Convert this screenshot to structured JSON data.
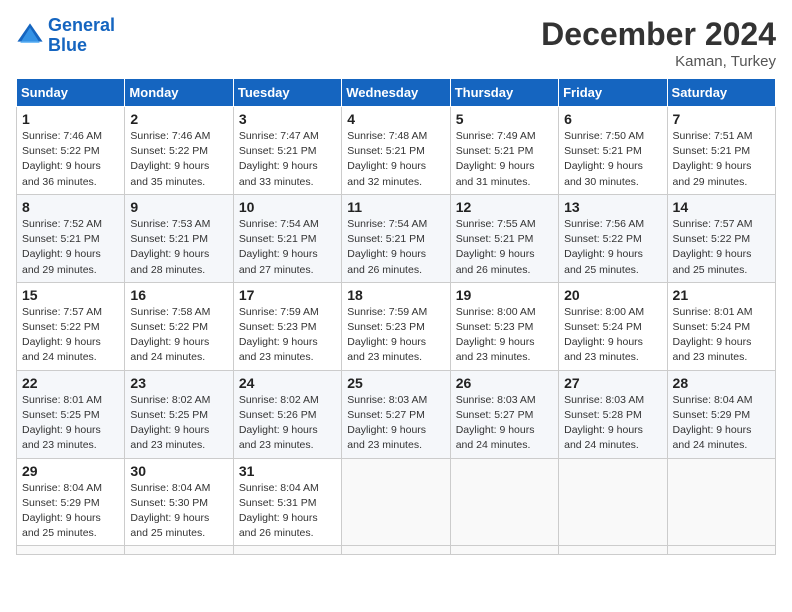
{
  "header": {
    "logo_line1": "General",
    "logo_line2": "Blue",
    "month_title": "December 2024",
    "location": "Kaman, Turkey"
  },
  "weekdays": [
    "Sunday",
    "Monday",
    "Tuesday",
    "Wednesday",
    "Thursday",
    "Friday",
    "Saturday"
  ],
  "days": [
    {
      "date": "",
      "sunrise": "",
      "sunset": "",
      "daylight": ""
    },
    {
      "date": "",
      "sunrise": "",
      "sunset": "",
      "daylight": ""
    },
    {
      "date": "",
      "sunrise": "",
      "sunset": "",
      "daylight": ""
    },
    {
      "date": "",
      "sunrise": "",
      "sunset": "",
      "daylight": ""
    },
    {
      "date": "",
      "sunrise": "",
      "sunset": "",
      "daylight": ""
    },
    {
      "date": "",
      "sunrise": "",
      "sunset": "",
      "daylight": ""
    },
    {
      "date": "1",
      "sunrise": "Sunrise: 7:46 AM",
      "sunset": "Sunset: 5:22 PM",
      "daylight": "Daylight: 9 hours and 36 minutes."
    },
    {
      "date": "2",
      "sunrise": "Sunrise: 7:46 AM",
      "sunset": "Sunset: 5:22 PM",
      "daylight": "Daylight: 9 hours and 35 minutes."
    },
    {
      "date": "3",
      "sunrise": "Sunrise: 7:47 AM",
      "sunset": "Sunset: 5:21 PM",
      "daylight": "Daylight: 9 hours and 33 minutes."
    },
    {
      "date": "4",
      "sunrise": "Sunrise: 7:48 AM",
      "sunset": "Sunset: 5:21 PM",
      "daylight": "Daylight: 9 hours and 32 minutes."
    },
    {
      "date": "5",
      "sunrise": "Sunrise: 7:49 AM",
      "sunset": "Sunset: 5:21 PM",
      "daylight": "Daylight: 9 hours and 31 minutes."
    },
    {
      "date": "6",
      "sunrise": "Sunrise: 7:50 AM",
      "sunset": "Sunset: 5:21 PM",
      "daylight": "Daylight: 9 hours and 30 minutes."
    },
    {
      "date": "7",
      "sunrise": "Sunrise: 7:51 AM",
      "sunset": "Sunset: 5:21 PM",
      "daylight": "Daylight: 9 hours and 29 minutes."
    },
    {
      "date": "8",
      "sunrise": "Sunrise: 7:52 AM",
      "sunset": "Sunset: 5:21 PM",
      "daylight": "Daylight: 9 hours and 29 minutes."
    },
    {
      "date": "9",
      "sunrise": "Sunrise: 7:53 AM",
      "sunset": "Sunset: 5:21 PM",
      "daylight": "Daylight: 9 hours and 28 minutes."
    },
    {
      "date": "10",
      "sunrise": "Sunrise: 7:54 AM",
      "sunset": "Sunset: 5:21 PM",
      "daylight": "Daylight: 9 hours and 27 minutes."
    },
    {
      "date": "11",
      "sunrise": "Sunrise: 7:54 AM",
      "sunset": "Sunset: 5:21 PM",
      "daylight": "Daylight: 9 hours and 26 minutes."
    },
    {
      "date": "12",
      "sunrise": "Sunrise: 7:55 AM",
      "sunset": "Sunset: 5:21 PM",
      "daylight": "Daylight: 9 hours and 26 minutes."
    },
    {
      "date": "13",
      "sunrise": "Sunrise: 7:56 AM",
      "sunset": "Sunset: 5:22 PM",
      "daylight": "Daylight: 9 hours and 25 minutes."
    },
    {
      "date": "14",
      "sunrise": "Sunrise: 7:57 AM",
      "sunset": "Sunset: 5:22 PM",
      "daylight": "Daylight: 9 hours and 25 minutes."
    },
    {
      "date": "15",
      "sunrise": "Sunrise: 7:57 AM",
      "sunset": "Sunset: 5:22 PM",
      "daylight": "Daylight: 9 hours and 24 minutes."
    },
    {
      "date": "16",
      "sunrise": "Sunrise: 7:58 AM",
      "sunset": "Sunset: 5:22 PM",
      "daylight": "Daylight: 9 hours and 24 minutes."
    },
    {
      "date": "17",
      "sunrise": "Sunrise: 7:59 AM",
      "sunset": "Sunset: 5:23 PM",
      "daylight": "Daylight: 9 hours and 23 minutes."
    },
    {
      "date": "18",
      "sunrise": "Sunrise: 7:59 AM",
      "sunset": "Sunset: 5:23 PM",
      "daylight": "Daylight: 9 hours and 23 minutes."
    },
    {
      "date": "19",
      "sunrise": "Sunrise: 8:00 AM",
      "sunset": "Sunset: 5:23 PM",
      "daylight": "Daylight: 9 hours and 23 minutes."
    },
    {
      "date": "20",
      "sunrise": "Sunrise: 8:00 AM",
      "sunset": "Sunset: 5:24 PM",
      "daylight": "Daylight: 9 hours and 23 minutes."
    },
    {
      "date": "21",
      "sunrise": "Sunrise: 8:01 AM",
      "sunset": "Sunset: 5:24 PM",
      "daylight": "Daylight: 9 hours and 23 minutes."
    },
    {
      "date": "22",
      "sunrise": "Sunrise: 8:01 AM",
      "sunset": "Sunset: 5:25 PM",
      "daylight": "Daylight: 9 hours and 23 minutes."
    },
    {
      "date": "23",
      "sunrise": "Sunrise: 8:02 AM",
      "sunset": "Sunset: 5:25 PM",
      "daylight": "Daylight: 9 hours and 23 minutes."
    },
    {
      "date": "24",
      "sunrise": "Sunrise: 8:02 AM",
      "sunset": "Sunset: 5:26 PM",
      "daylight": "Daylight: 9 hours and 23 minutes."
    },
    {
      "date": "25",
      "sunrise": "Sunrise: 8:03 AM",
      "sunset": "Sunset: 5:27 PM",
      "daylight": "Daylight: 9 hours and 23 minutes."
    },
    {
      "date": "26",
      "sunrise": "Sunrise: 8:03 AM",
      "sunset": "Sunset: 5:27 PM",
      "daylight": "Daylight: 9 hours and 24 minutes."
    },
    {
      "date": "27",
      "sunrise": "Sunrise: 8:03 AM",
      "sunset": "Sunset: 5:28 PM",
      "daylight": "Daylight: 9 hours and 24 minutes."
    },
    {
      "date": "28",
      "sunrise": "Sunrise: 8:04 AM",
      "sunset": "Sunset: 5:29 PM",
      "daylight": "Daylight: 9 hours and 24 minutes."
    },
    {
      "date": "29",
      "sunrise": "Sunrise: 8:04 AM",
      "sunset": "Sunset: 5:29 PM",
      "daylight": "Daylight: 9 hours and 25 minutes."
    },
    {
      "date": "30",
      "sunrise": "Sunrise: 8:04 AM",
      "sunset": "Sunset: 5:30 PM",
      "daylight": "Daylight: 9 hours and 25 minutes."
    },
    {
      "date": "31",
      "sunrise": "Sunrise: 8:04 AM",
      "sunset": "Sunset: 5:31 PM",
      "daylight": "Daylight: 9 hours and 26 minutes."
    }
  ]
}
